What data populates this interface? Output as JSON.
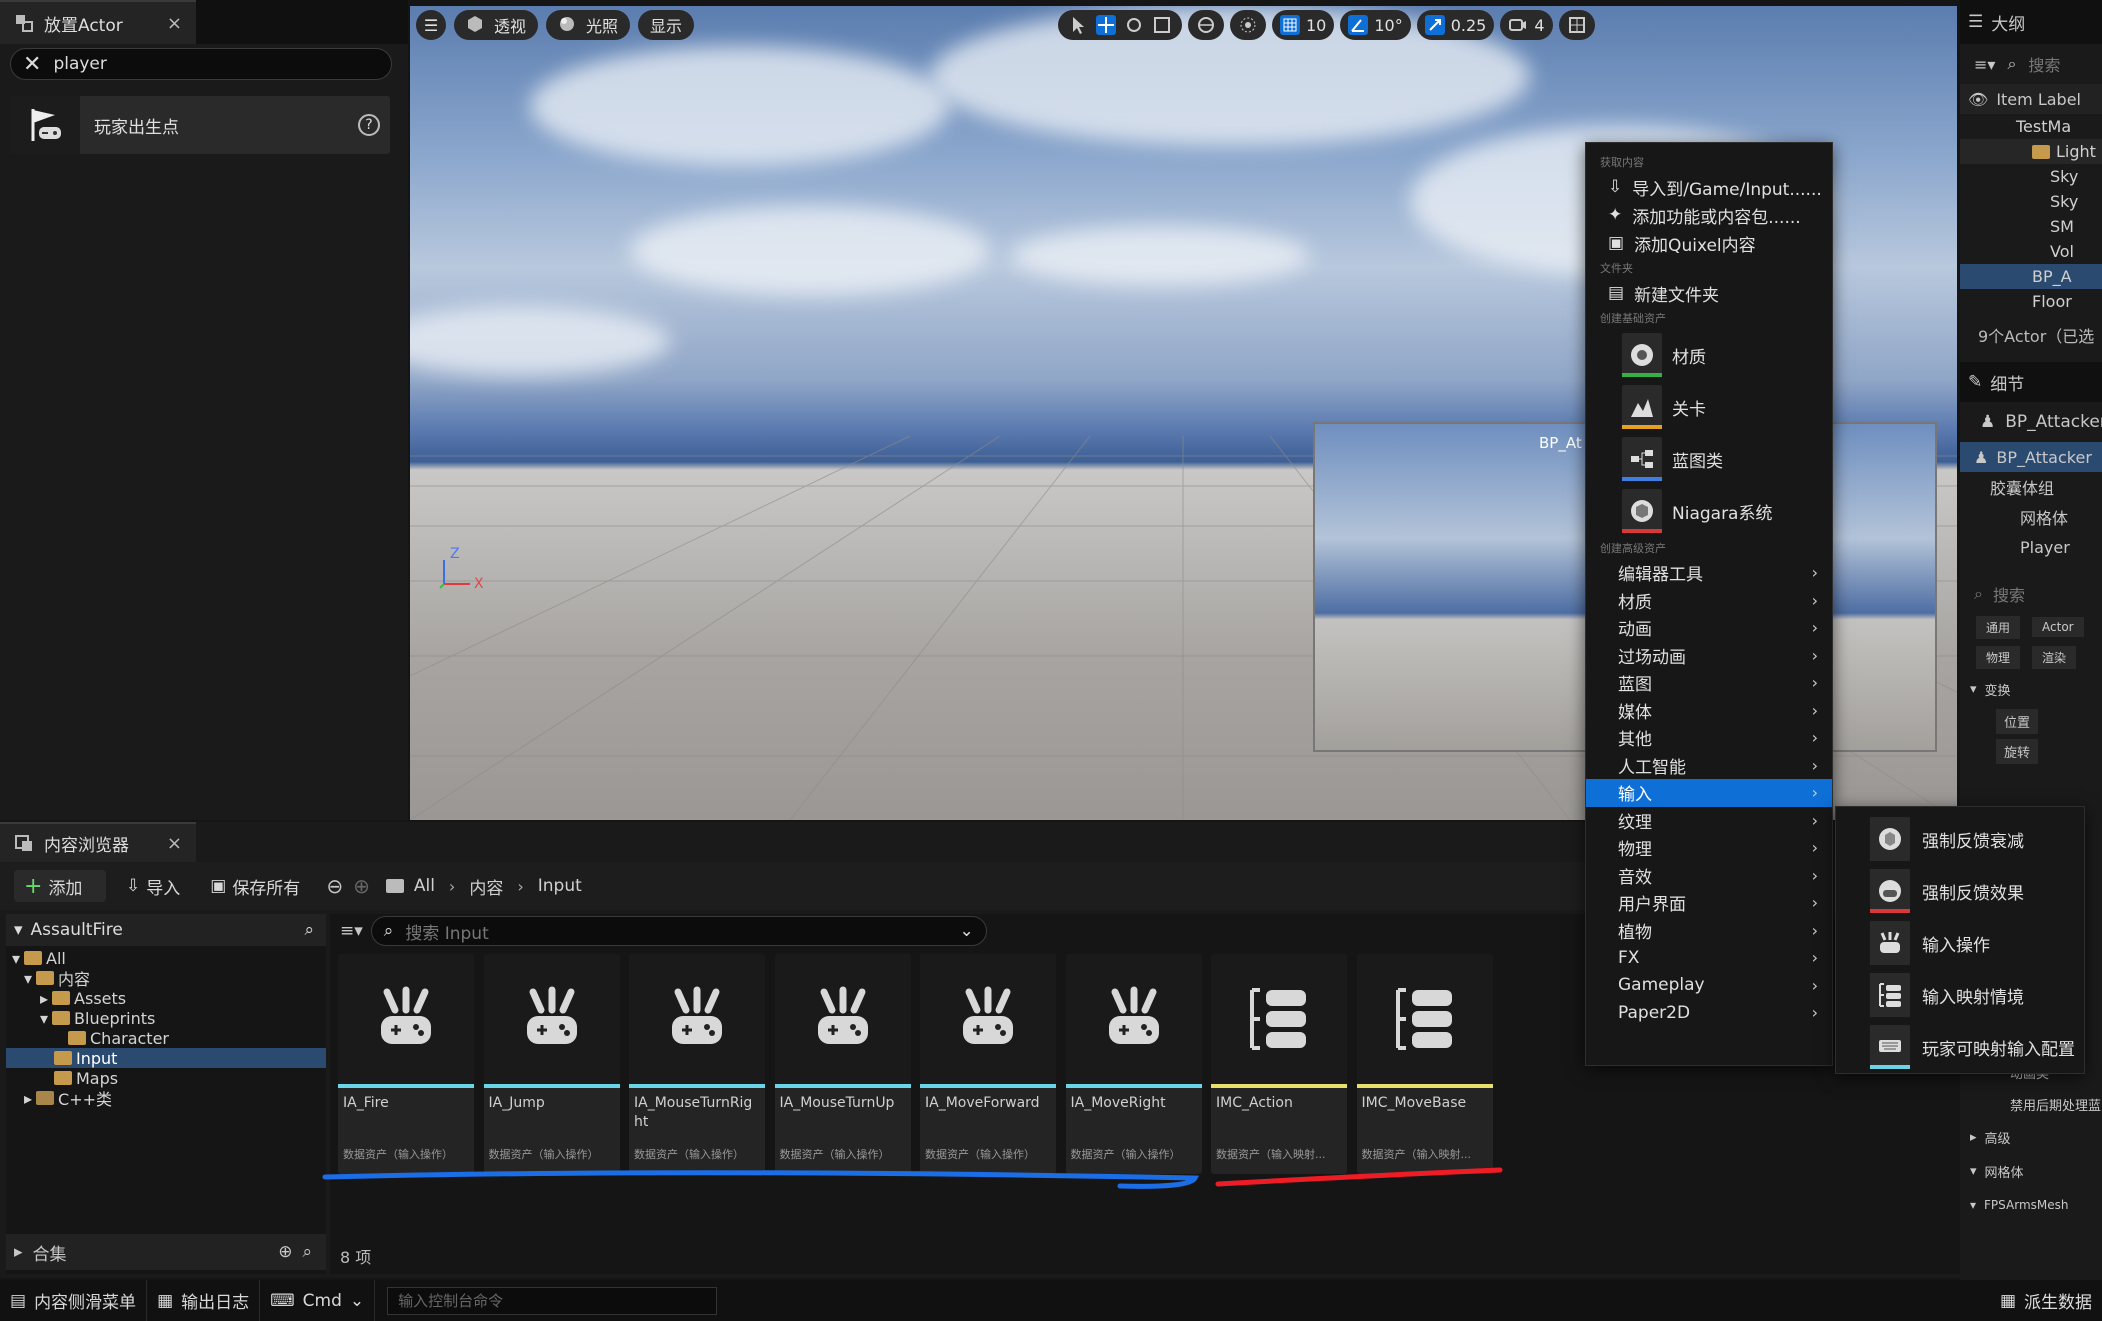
{
  "colors": {
    "accent_blue": "#0e6fd6",
    "annotation_blue": "#1b6ee6",
    "annotation_red": "#ee1c24",
    "action_bar": "#6ad5e8",
    "context_bar": "#e8e06a",
    "material_green": "#35b045",
    "level_orange": "#e8a020",
    "blueprint_blue": "#3e7ee0",
    "niagara_red": "#d83838"
  },
  "place_actor": {
    "tab_title": "放置Actor",
    "search_value": "player",
    "item_label": "玩家出生点"
  },
  "viewport": {
    "perspective_label": "透视",
    "lit_label": "光照",
    "show_label": "显示",
    "grid_snap": "10",
    "rotation_snap": "10°",
    "scale_snap": "0.25",
    "camera_speed": "4",
    "preview_label": "BP_At",
    "axis_z": "Z",
    "axis_x": "X"
  },
  "outliner": {
    "tab_title": "大纲",
    "search_placeholder": "搜索",
    "column_label": "Item Label",
    "rows": [
      "TestMa",
      "Light",
      "Sky",
      "Sky",
      "SM",
      "Vol",
      "BP_A",
      "Floor"
    ],
    "summary": "9个Actor（已选",
    "details_title": "细节",
    "details_actor": "BP_Attacker",
    "details_component": "BP_Attacker",
    "comp_capsule": "胶囊体组",
    "comp_mesh": "网格体",
    "comp_player": "Player",
    "details_search": "搜索",
    "filter_general": "通用",
    "filter_actor": "Actor",
    "filter_physics": "物理",
    "filter_render": "渲染",
    "section_transform": "变换",
    "field_location": "位置",
    "field_rotation": "旋转",
    "field_animclass": "动画类",
    "field_disable_post": "禁用后期处理蓝",
    "section_advanced": "高级",
    "section_mesh": "网格体",
    "section_fpsarms": "FPSArmsMesh",
    "derive_data": "派生数据"
  },
  "content_browser": {
    "tab_title": "内容浏览器",
    "add_label": "添加",
    "import_label": "导入",
    "save_all_label": "保存所有",
    "breadcrumbs": [
      "All",
      "内容",
      "Input"
    ],
    "project_name": "AssaultFire",
    "tree": [
      {
        "label": "All",
        "depth": 0
      },
      {
        "label": "内容",
        "depth": 1
      },
      {
        "label": "Assets",
        "depth": 2
      },
      {
        "label": "Blueprints",
        "depth": 2
      },
      {
        "label": "Character",
        "depth": 3
      },
      {
        "label": "Input",
        "depth": 2
      },
      {
        "label": "Maps",
        "depth": 2
      },
      {
        "label": "C++类",
        "depth": 1
      }
    ],
    "collections_label": "合集",
    "search_placeholder": "搜索 Input",
    "assets": [
      {
        "name": "IA_Fire",
        "type": "数据资产（输入操作）",
        "kind": "action"
      },
      {
        "name": "IA_Jump",
        "type": "数据资产（输入操作）",
        "kind": "action"
      },
      {
        "name": "IA_MouseTurnRight",
        "type": "数据资产（输入操作）",
        "kind": "action"
      },
      {
        "name": "IA_MouseTurnUp",
        "type": "数据资产（输入操作）",
        "kind": "action"
      },
      {
        "name": "IA_MoveForward",
        "type": "数据资产（输入操作）",
        "kind": "action"
      },
      {
        "name": "IA_MoveRight",
        "type": "数据资产（输入操作）",
        "kind": "action"
      },
      {
        "name": "IMC_Action",
        "type": "数据资产（输入映射...",
        "kind": "context"
      },
      {
        "name": "IMC_MoveBase",
        "type": "数据资产（输入映射...",
        "kind": "context"
      }
    ],
    "item_count": "8 项"
  },
  "statusbar": {
    "drawer": "内容侧滑菜单",
    "output_log": "输出日志",
    "cmd": "Cmd",
    "console_placeholder": "输入控制台命令"
  },
  "context_menu": {
    "section_get": "获取内容",
    "import_to": "导入到/Game/Input......",
    "add_feature": "添加功能或内容包......",
    "add_quixel": "添加Quixel内容",
    "section_folder": "文件夹",
    "new_folder": "新建文件夹",
    "section_basic": "创建基础资产",
    "basic": [
      "材质",
      "关卡",
      "蓝图类",
      "Niagara系统"
    ],
    "section_advanced": "创建高级资产",
    "advanced": [
      "编辑器工具",
      "材质",
      "动画",
      "过场动画",
      "蓝图",
      "媒体",
      "其他",
      "人工智能",
      "输入",
      "纹理",
      "物理",
      "音效",
      "用户界面",
      "植物",
      "FX",
      "Gameplay",
      "Paper2D"
    ],
    "active_index": 8
  },
  "submenu": {
    "items": [
      "强制反馈衰减",
      "强制反馈效果",
      "输入操作",
      "输入映射情境",
      "玩家可映射输入配置"
    ]
  }
}
